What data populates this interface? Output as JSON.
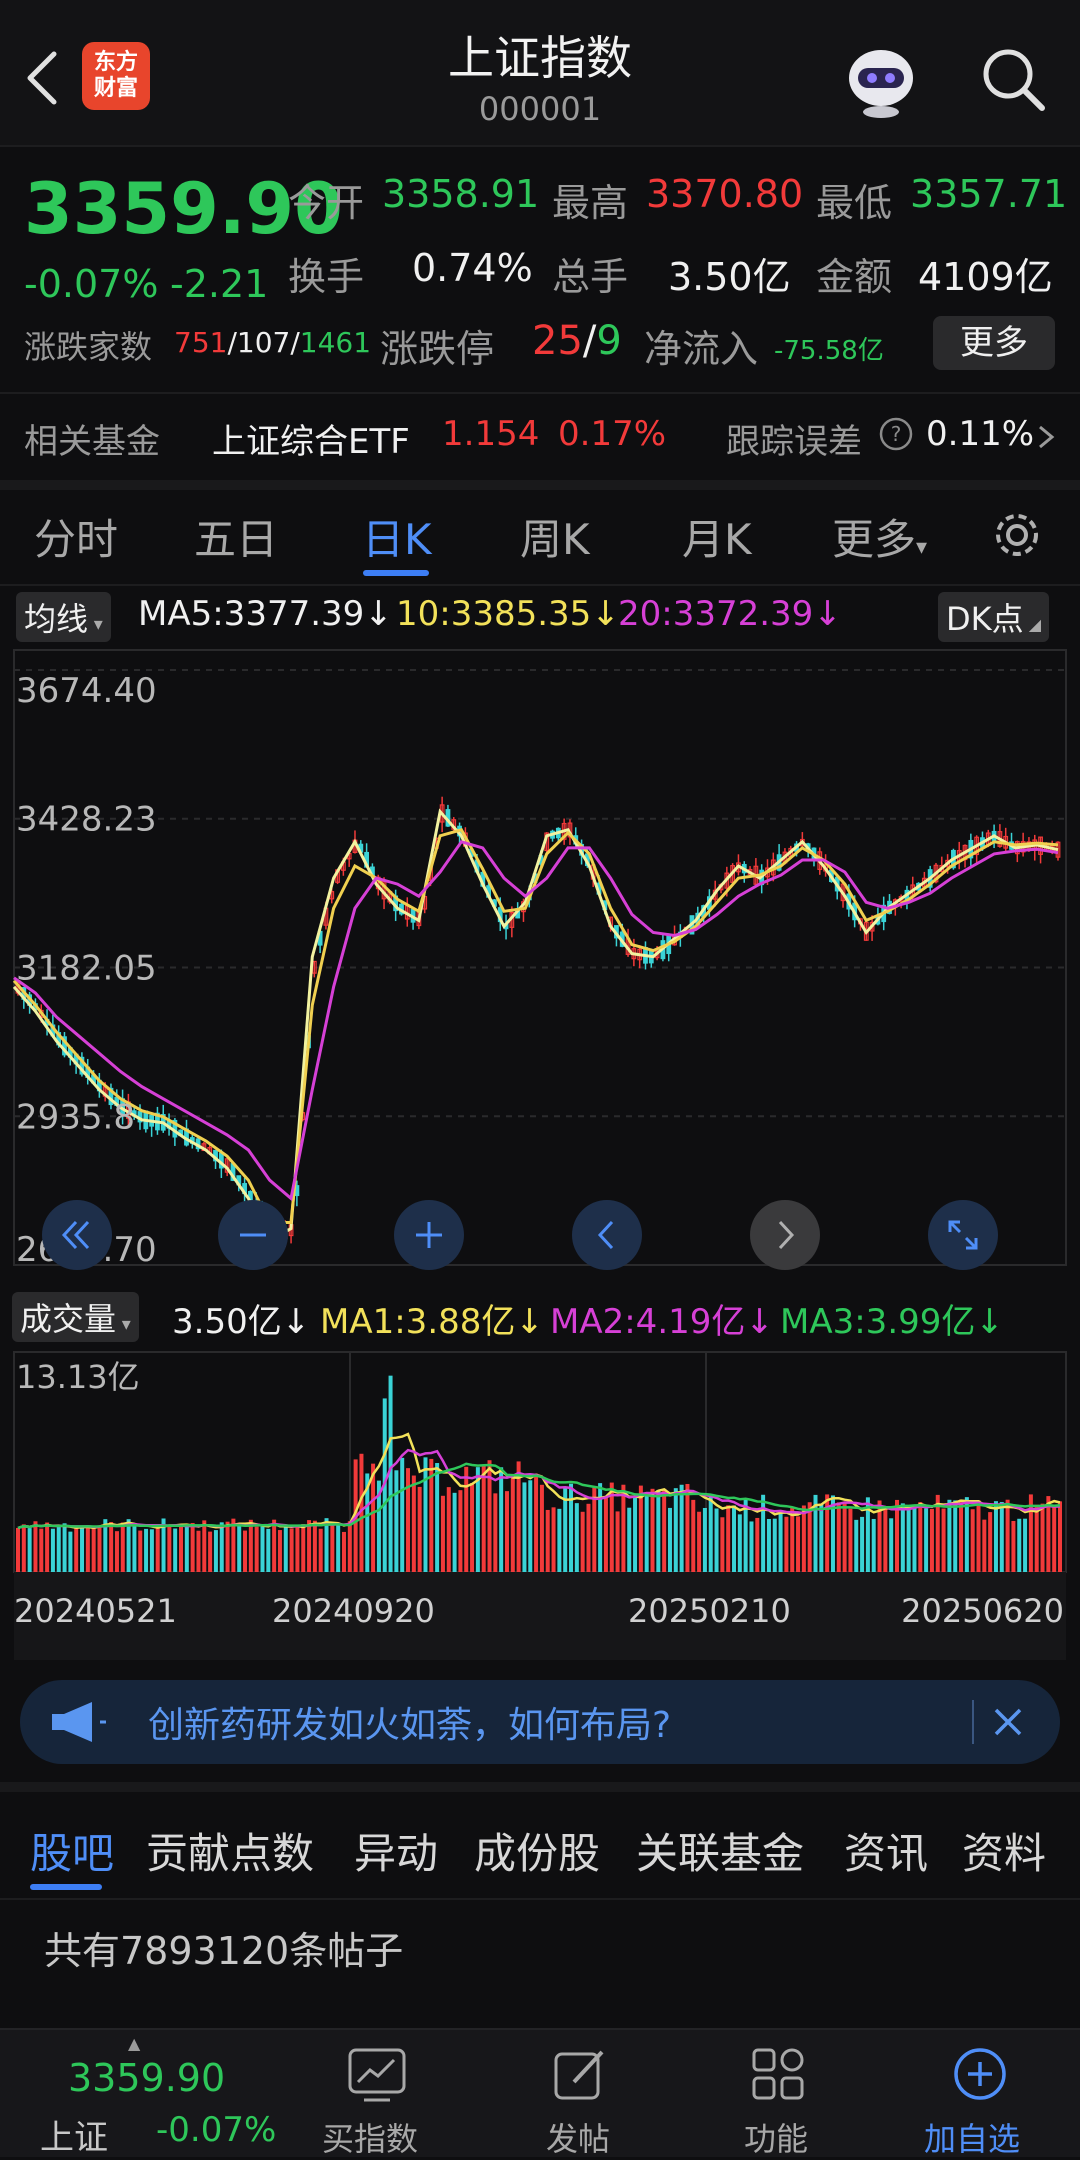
{
  "header": {
    "title": "上证指数",
    "code": "000001",
    "logo_line1": "东方",
    "logo_line2": "财富"
  },
  "quote": {
    "price": "3359.90",
    "change_pct": "-0.07%",
    "change": "-2.21",
    "open_label": "今开",
    "open": "3358.91",
    "high_label": "最高",
    "high": "3370.80",
    "low_label": "最低",
    "low": "3357.71",
    "turnover_label": "换手",
    "turnover": "0.74%",
    "volume_label": "总手",
    "volume": "3.50亿",
    "amount_label": "金额",
    "amount": "4109亿",
    "breadth_label": "涨跌家数",
    "adv": "751",
    "flat": "107",
    "dec": "1461",
    "limit_label": "涨跌停",
    "limit_up": "25",
    "limit_down": "9",
    "netflow_label": "净流入",
    "netflow": "-75.58亿",
    "more_label": "更多"
  },
  "fund": {
    "label": "相关基金",
    "name": "上证综合ETF",
    "price": "1.154",
    "pct": "0.17%",
    "track_label": "跟踪误差",
    "track_value": "0.11%"
  },
  "tabs": [
    "分时",
    "五日",
    "日K",
    "周K",
    "月K",
    "更多"
  ],
  "ma": {
    "selector": "均线",
    "ma5": "MA5:3377.39",
    "ma10": "10:3385.35",
    "ma20": "20:3372.39",
    "dk": "DK点"
  },
  "volume": {
    "selector": "成交量",
    "value": "3.50亿",
    "ma1": "MA1:3.88亿",
    "ma2": "MA2:4.19亿",
    "ma3": "MA3:3.99亿",
    "max_label": "13.13亿"
  },
  "chart_data": {
    "type": "line",
    "y_ticks": [
      "3674.40",
      "3428.23",
      "3182.05",
      "2935.8",
      "2689.70"
    ],
    "ylim": [
      2689.7,
      3674.4
    ],
    "x_ticks": [
      "20240521",
      "20240920",
      "20250210",
      "20250620"
    ],
    "series": [
      {
        "name": "MA5",
        "color": "#f2f2a0",
        "values": [
          3150,
          3110,
          3060,
          3020,
          2980,
          2950,
          2930,
          2925,
          2900,
          2880,
          2850,
          2800,
          2730,
          2750,
          3200,
          3330,
          3390,
          3320,
          3280,
          3260,
          3440,
          3400,
          3320,
          3250,
          3290,
          3400,
          3410,
          3350,
          3250,
          3205,
          3200,
          3230,
          3260,
          3310,
          3350,
          3330,
          3360,
          3390,
          3350,
          3300,
          3240,
          3280,
          3305,
          3330,
          3360,
          3380,
          3400,
          3380,
          3385,
          3377
        ]
      },
      {
        "name": "MA10",
        "color": "#f0d050",
        "values": [
          3160,
          3120,
          3075,
          3035,
          2995,
          2965,
          2945,
          2935,
          2915,
          2895,
          2870,
          2830,
          2760,
          2760,
          3120,
          3280,
          3350,
          3330,
          3295,
          3275,
          3400,
          3410,
          3345,
          3275,
          3280,
          3370,
          3405,
          3370,
          3280,
          3220,
          3210,
          3225,
          3250,
          3290,
          3330,
          3335,
          3350,
          3380,
          3360,
          3320,
          3260,
          3275,
          3295,
          3320,
          3350,
          3370,
          3390,
          3385,
          3388,
          3385
        ]
      },
      {
        "name": "MA20",
        "color": "#d640d6",
        "values": [
          3165,
          3140,
          3100,
          3070,
          3040,
          3010,
          2985,
          2965,
          2945,
          2925,
          2905,
          2880,
          2830,
          2800,
          2980,
          3150,
          3280,
          3330,
          3320,
          3300,
          3340,
          3390,
          3380,
          3330,
          3300,
          3330,
          3380,
          3380,
          3330,
          3270,
          3240,
          3235,
          3245,
          3270,
          3300,
          3320,
          3335,
          3360,
          3360,
          3340,
          3290,
          3280,
          3290,
          3305,
          3330,
          3350,
          3370,
          3375,
          3378,
          3372
        ]
      }
    ],
    "volume_series": [
      {
        "name": "MA1",
        "color": "#f2e15a"
      },
      {
        "name": "MA2",
        "color": "#d640d6"
      },
      {
        "name": "MA3",
        "color": "#2ec75a"
      }
    ]
  },
  "banner": {
    "text": "创新药研发如火如荼，如何布局?"
  },
  "bottom_tabs": [
    "股吧",
    "贡献点数",
    "异动",
    "成份股",
    "关联基金",
    "资讯",
    "资料"
  ],
  "posts": {
    "text": "共有7893120条帖子"
  },
  "nav": {
    "index_price": "3359.90",
    "index_name": "上证",
    "index_pct": "-0.07%",
    "items": [
      "买指数",
      "发帖",
      "功能",
      "加自选"
    ]
  },
  "colors": {
    "up": "#f23a3a",
    "down": "#2ec75a",
    "accent": "#3d7ef5"
  }
}
